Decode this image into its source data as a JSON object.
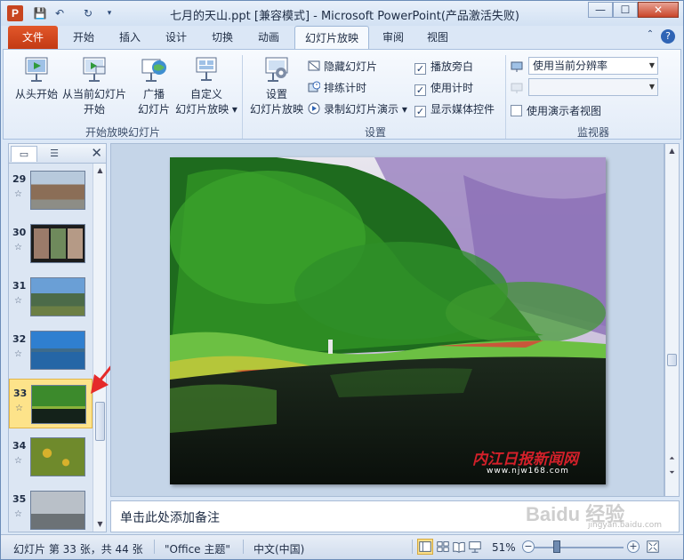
{
  "window": {
    "title": "七月的天山.ppt [兼容模式] - Microsoft PowerPoint(产品激活失败)",
    "controls": {
      "minimize": "—",
      "restore": "☐",
      "close": "✕"
    }
  },
  "quick_access": {
    "save": "💾",
    "undo": "↶",
    "redo": "↻"
  },
  "tabs": [
    {
      "label": "文件"
    },
    {
      "label": "开始"
    },
    {
      "label": "插入"
    },
    {
      "label": "设计"
    },
    {
      "label": "切换"
    },
    {
      "label": "动画"
    },
    {
      "label": "幻灯片放映"
    },
    {
      "label": "审阅"
    },
    {
      "label": "视图"
    }
  ],
  "ribbon_controls": {
    "help": "?",
    "collapse": "⌃"
  },
  "ribbon": {
    "group_start": {
      "label": "开始放映幻灯片",
      "from_beginning_l1": "从头开始",
      "from_current_l1": "从当前幻灯片",
      "from_current_l2": "开始",
      "broadcast_l1": "广播",
      "broadcast_l2": "幻灯片",
      "custom_l1": "自定义",
      "custom_l2": "幻灯片放映 ▾"
    },
    "group_setup": {
      "label": "设置",
      "setup_l1": "设置",
      "setup_l2": "幻灯片放映",
      "hide_slide": "隐藏幻灯片",
      "rehearse": "排练计时",
      "record": "录制幻灯片演示 ▾",
      "play_narrations": "播放旁白",
      "use_timings": "使用计时",
      "show_media_controls": "显示媒体控件"
    },
    "group_monitors": {
      "label": "监视器",
      "resolution": "使用当前分辨率",
      "monitor": "",
      "presenter_view": "使用演示者视图"
    }
  },
  "slide_pane": {
    "close": "✕",
    "slides": [
      {
        "num": "29"
      },
      {
        "num": "30"
      },
      {
        "num": "31"
      },
      {
        "num": "32"
      },
      {
        "num": "33",
        "selected": true
      },
      {
        "num": "34"
      },
      {
        "num": "35"
      }
    ],
    "star": "☆"
  },
  "slide": {
    "watermark": "内江日报新闻网",
    "watermark_url": "www.njw168.com"
  },
  "notes": {
    "placeholder": "单击此处添加备注"
  },
  "status": {
    "slide_info": "幻灯片 第 33 张，共 44 张",
    "theme": "\"Office 主题\"",
    "language": "中文(中国)",
    "zoom": "51%",
    "zoom_minus": "−",
    "zoom_plus": "+"
  },
  "overlay": {
    "baidu": "Baidu 经验",
    "baidu_url": "jingyan.baidu.com"
  },
  "colors": {
    "file_tab": "#d24a1f",
    "accent": "#2c4a78",
    "selection": "#fde38a"
  }
}
